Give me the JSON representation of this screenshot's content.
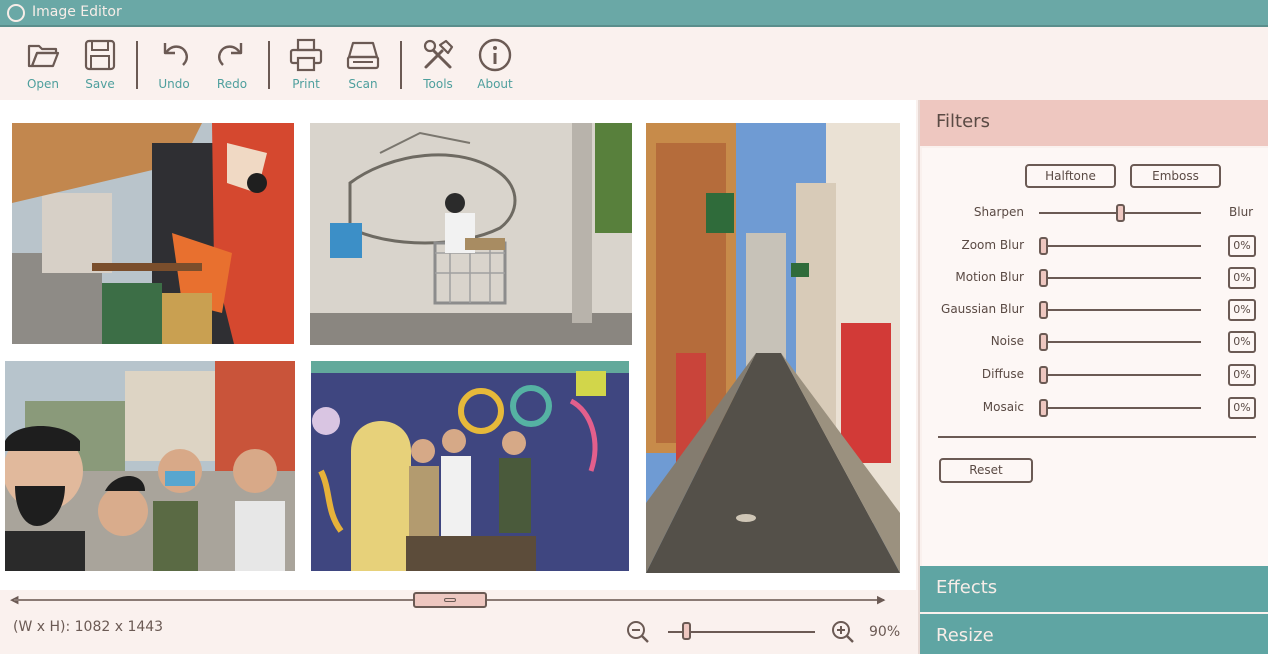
{
  "window": {
    "title": "Image Editor"
  },
  "toolbar": {
    "open": "Open",
    "save": "Save",
    "undo": "Undo",
    "redo": "Redo",
    "print": "Print",
    "scan": "Scan",
    "tools": "Tools",
    "about": "About"
  },
  "status": {
    "dimensions": "(W x H): 1082 x 1443",
    "zoom": "90%",
    "zoom_fraction": 0.12
  },
  "panel": {
    "filters_title": "Filters",
    "halftone": "Halftone",
    "emboss": "Emboss",
    "sharpen": {
      "label": "Sharpen",
      "right_label": "Blur",
      "level": 0.5
    },
    "filters": [
      {
        "label": "Zoom Blur",
        "value": "0%"
      },
      {
        "label": "Motion Blur",
        "value": "0%"
      },
      {
        "label": "Gaussian Blur",
        "value": "0%"
      },
      {
        "label": "Noise",
        "value": "0%"
      },
      {
        "label": "Diffuse",
        "value": "0%"
      },
      {
        "label": "Mosaic",
        "value": "0%"
      }
    ],
    "reset": "Reset",
    "effects_title": "Effects",
    "resize_title": "Resize"
  },
  "colors": {
    "teal": "#6aa8a6",
    "pink": "#eec7c0",
    "cream": "#faf1ee",
    "brown": "#6b5a54"
  }
}
